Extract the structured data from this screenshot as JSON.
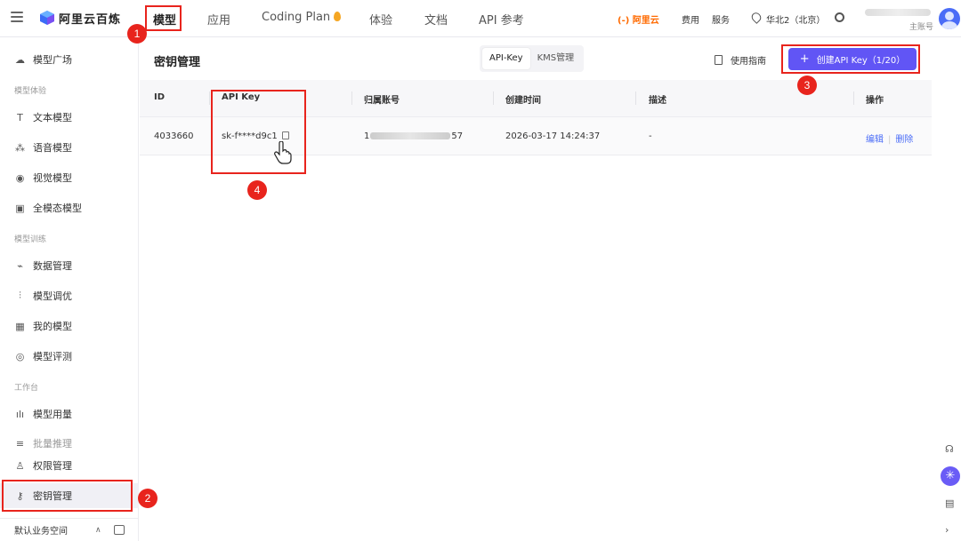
{
  "header": {
    "brand": "阿里云百炼",
    "nav": [
      "模型",
      "应用",
      "Coding Plan",
      "体验",
      "文档",
      "API 参考"
    ],
    "aliyun": "(-) 阿里云",
    "links": [
      "费用",
      "服务"
    ],
    "region": "华北2（北京）",
    "account_sub": "主账号"
  },
  "sidebar": {
    "top_item": "模型广场",
    "sections": [
      {
        "title": "模型体验",
        "items": [
          "文本模型",
          "语音模型",
          "视觉模型",
          "全模态模型"
        ]
      },
      {
        "title": "模型训练",
        "items": [
          "数据管理",
          "模型调优",
          "我的模型",
          "模型评测"
        ]
      },
      {
        "title": "工作台",
        "items": [
          "模型用量",
          "批量推理",
          "权限管理",
          "密钥管理"
        ]
      }
    ],
    "workspace": "默认业务空间"
  },
  "main": {
    "title": "密钥管理",
    "tabs": [
      "API-Key",
      "KMS管理"
    ],
    "guide": "使用指南",
    "create_button": "创建API Key（1/20）",
    "columns": [
      "ID",
      "API Key",
      "归属账号",
      "创建时间",
      "描述",
      "操作"
    ],
    "rows": [
      {
        "id": "4033660",
        "api_key": "sk-f****d9c1",
        "account_prefix": "1",
        "account_suffix": "57",
        "created": "2026-03-17 14:24:37",
        "desc": "-",
        "edit": "编辑",
        "delete": "删除"
      }
    ]
  },
  "annotations": [
    "1",
    "2",
    "3",
    "4"
  ],
  "colors": {
    "accent": "#6155f5",
    "highlight": "#e8241d",
    "link": "#4a6cf7"
  }
}
